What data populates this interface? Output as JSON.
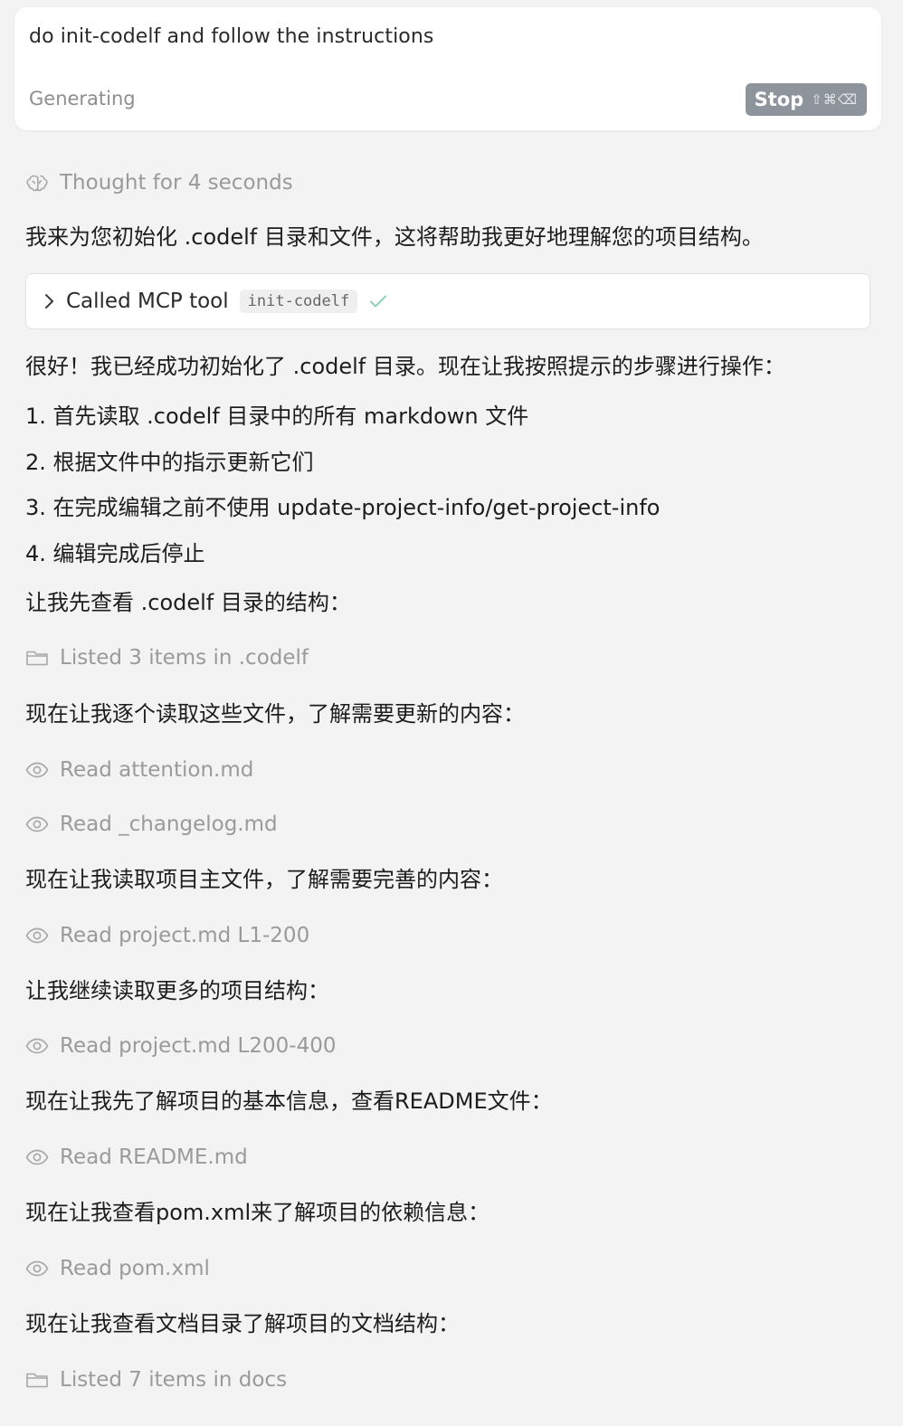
{
  "prompt": {
    "text": "do init-codelf and follow the instructions",
    "status": "Generating",
    "stop_label": "Stop",
    "stop_shortcut": "⇧⌘⌫"
  },
  "thought": {
    "label": "Thought for 4 seconds",
    "icon": "brain-icon"
  },
  "messages": {
    "m1": "我来为您初始化 .codelf 目录和文件，这将帮助我更好地理解您的项目结构。",
    "m2": "很好！我已经成功初始化了 .codelf 目录。现在让我按照提示的步骤进行操作：",
    "step1": "1. 首先读取 .codelf 目录中的所有 markdown 文件",
    "step2": "2. 根据文件中的指示更新它们",
    "step3": "3. 在完成编辑之前不使用 update-project-info/get-project-info",
    "step4": "4. 编辑完成后停止",
    "m3": "让我先查看 .codelf 目录的结构：",
    "m4": "现在让我逐个读取这些文件，了解需要更新的内容：",
    "m5": "现在让我读取项目主文件，了解需要完善的内容：",
    "m6": "让我继续读取更多的项目结构：",
    "m7": "现在让我先了解项目的基本信息，查看README文件：",
    "m8": "现在让我查看pom.xml来了解项目的依赖信息：",
    "m9": "现在让我查看文档目录了解项目的文档结构："
  },
  "tool_call": {
    "label": "Called MCP tool",
    "tool_name": "init-codelf",
    "status_icon": "check-icon"
  },
  "actions": {
    "a1": "Listed 3 items in .codelf",
    "a2": "Read attention.md",
    "a3": "Read _changelog.md",
    "a4": "Read project.md L1-200",
    "a5": "Read project.md L200-400",
    "a6": "Read README.md",
    "a7": "Read pom.xml",
    "a8": "Listed 7 items in docs"
  },
  "colors": {
    "background": "#f3f3f3",
    "card": "#ffffff",
    "muted_text": "#9a9a9a",
    "stop_button": "#8d949b",
    "check": "#8fd1b0"
  }
}
